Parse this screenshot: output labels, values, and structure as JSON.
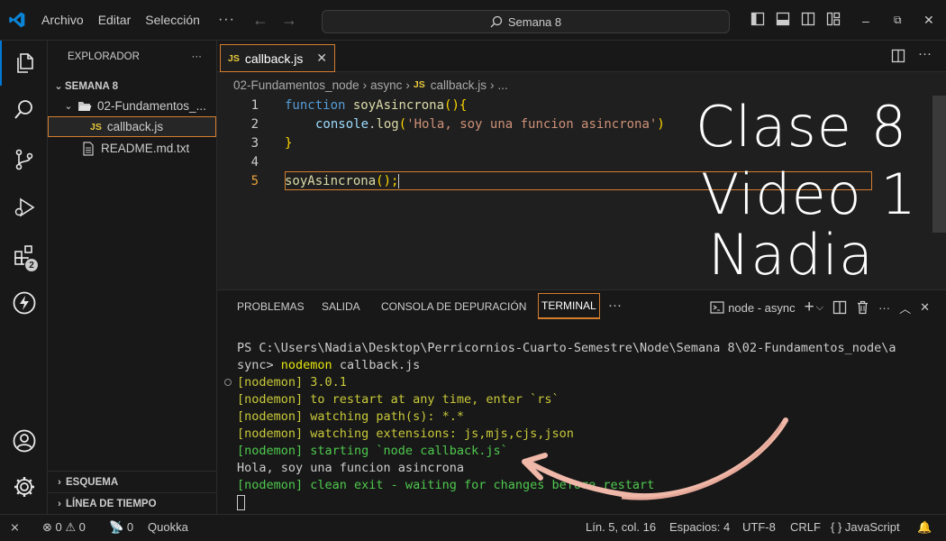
{
  "menu": {
    "file": "Archivo",
    "edit": "Editar",
    "selection": "Selección",
    "more": "···"
  },
  "search": {
    "label": "Semana 8"
  },
  "explorer": {
    "title": "EXPLORADOR",
    "more": "···",
    "root": "SEMANA 8",
    "folder": "02-Fundamentos_...",
    "files": [
      {
        "badge": "JS",
        "name": "callback.js"
      },
      {
        "name": "README.md.txt"
      }
    ],
    "outline": "ESQUEMA",
    "timeline": "LÍNEA DE TIEMPO"
  },
  "activity": {
    "extensions_badge": "2"
  },
  "tab": {
    "badge": "JS",
    "name": "callback.js",
    "close": "✕"
  },
  "breadcrumb": [
    "02-Fundamentos_node",
    "async",
    "callback.js",
    "..."
  ],
  "breadcrumb_js": "JS",
  "code": {
    "line_numbers": [
      "1",
      "2",
      "3",
      "4",
      "5"
    ],
    "l1_kw": "function",
    "l1_fn": "soyAsincrona",
    "l1_open": "(){",
    "l2_obj": "console",
    "l2_dot": ".",
    "l2_fn": "log",
    "l2_po": "(",
    "l2_str": "'Hola, soy una funcion asincrona'",
    "l2_pc": ")",
    "l3": "}",
    "l5_fn": "soyAsincrona",
    "l5_rest": "();"
  },
  "overlay": {
    "line1": "Clase 8",
    "line2": "Video 1",
    "line3": "Nadia"
  },
  "panel": {
    "tabs": [
      "PROBLEMAS",
      "SALIDA",
      "CONSOLA DE DEPURACIÓN",
      "TERMINAL"
    ],
    "more": "···",
    "terminal_name": "node - async"
  },
  "terminal": {
    "prompt1": "PS C:\\Users\\Nadia\\Desktop\\Perricornios-Cuarto-Semestre\\Node\\Semana 8\\02-Fundamentos_node\\a",
    "prompt2": "sync> ",
    "cmd": "nodemon",
    "cmd_arg": " callback.js",
    "lines": [
      "[nodemon] 3.0.1",
      "[nodemon] to restart at any time, enter `rs`",
      "[nodemon] watching path(s): *.*",
      "[nodemon] watching extensions: js,mjs,cjs,json"
    ],
    "starting": "[nodemon] starting `node callback.js`",
    "output": "Hola, soy una funcion asincrona",
    "exit": "[nodemon] clean exit - waiting for changes before restart"
  },
  "status": {
    "errors": "0",
    "warnings": "0",
    "ports": "0",
    "quokka": "Quokka",
    "position": "Lín. 5, col. 16",
    "spaces": "Espacios: 4",
    "encoding": "UTF-8",
    "eol": "CRLF",
    "language_icon": "{ }",
    "language": "JavaScript"
  }
}
